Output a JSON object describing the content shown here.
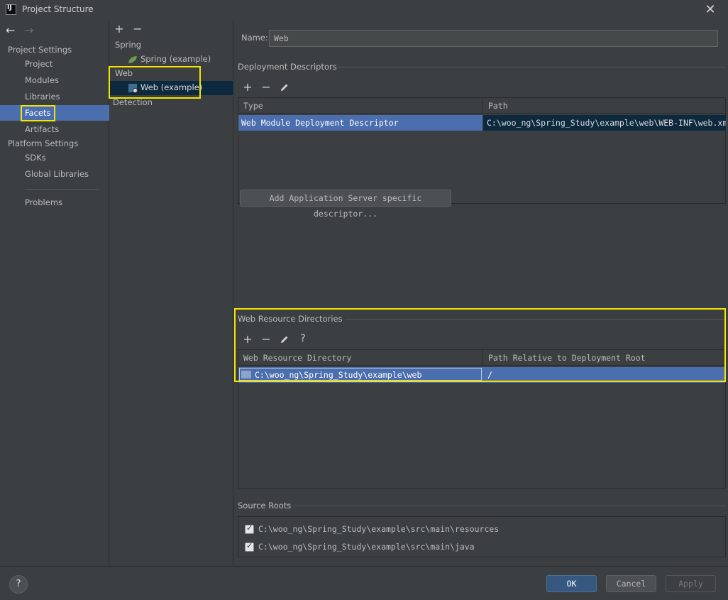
{
  "window": {
    "title": "Project Structure",
    "app_icon_text": "IJ"
  },
  "nav": {
    "back_icon": "←",
    "forward_icon": "→",
    "project_settings_heading": "Project Settings",
    "project_items": [
      "Project",
      "Modules",
      "Libraries",
      "Facets",
      "Artifacts"
    ],
    "platform_settings_heading": "Platform Settings",
    "platform_items": [
      "SDKs",
      "Global Libraries"
    ],
    "problems": "Problems",
    "selected": "Facets"
  },
  "tree": {
    "add_icon": "+",
    "remove_icon": "−",
    "spring_group": "Spring",
    "spring_item": "Spring (example)",
    "web_group": "Web",
    "web_item": "Web (example)",
    "detection": "Detection"
  },
  "name_field": {
    "label": "Name:",
    "value": "Web"
  },
  "deployment": {
    "title": "Deployment Descriptors",
    "columns": [
      "Type",
      "Path"
    ],
    "rows": [
      {
        "type": "Web Module Deployment Descriptor",
        "path": "C:\\woo_ng\\Spring_Study\\example\\web\\WEB-INF\\web.xml"
      }
    ],
    "add_button": "Add Application Server specific descriptor..."
  },
  "web_resources": {
    "title": "Web Resource Directories",
    "columns": [
      "Web Resource Directory",
      "Path Relative to Deployment Root"
    ],
    "rows": [
      {
        "directory": "C:\\woo_ng\\Spring_Study\\example\\web",
        "relative": "/"
      }
    ],
    "help_icon": "?"
  },
  "source_roots": {
    "title": "Source Roots",
    "items": [
      {
        "path": "C:\\woo_ng\\Spring_Study\\example\\src\\main\\resources",
        "checked": true
      },
      {
        "path": "C:\\woo_ng\\Spring_Study\\example\\src\\main\\java",
        "checked": true
      }
    ]
  },
  "buttons": {
    "ok": "OK",
    "cancel": "Cancel",
    "apply": "Apply",
    "help": "?"
  },
  "colors": {
    "selection": "#4b6eaf",
    "highlight": "#f5e400",
    "background": "#3c3f41",
    "underline": "#e0201c"
  }
}
